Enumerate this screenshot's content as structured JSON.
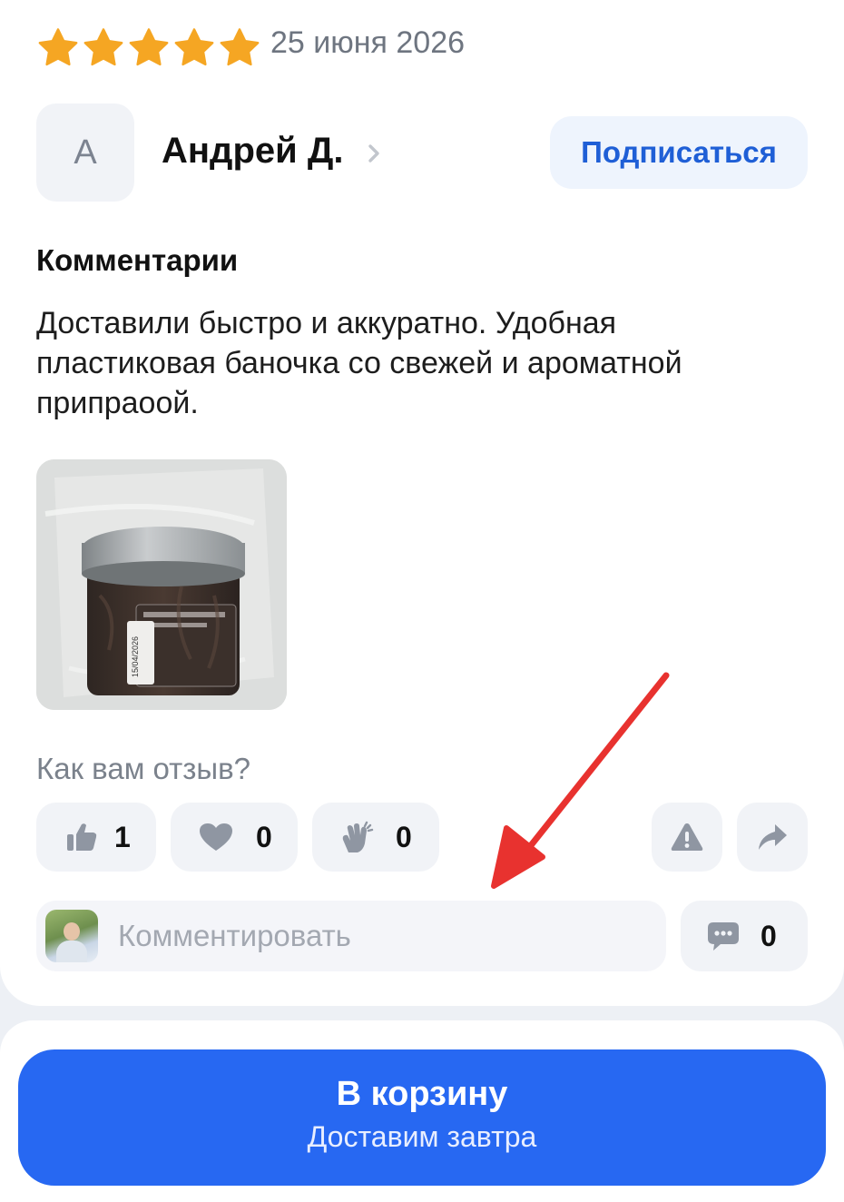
{
  "review": {
    "rating": 5,
    "date": "25 июня 2026",
    "author_initial": "А",
    "author_name": "Андрей Д.",
    "subscribe_label": "Подписаться",
    "comments_title": "Комментарии",
    "comment_text": "Доставили быстро и аккуратно. Удобная пластиковая баночка со свежей и ароматной припраоой.",
    "photo_label_date": "15/04/2026"
  },
  "feedback": {
    "question": "Как вам отзыв?",
    "likes": "1",
    "hearts": "0",
    "claps": "0"
  },
  "comment_box": {
    "placeholder": "Комментировать",
    "comments_count": "0"
  },
  "cart": {
    "button_label": "В корзину",
    "delivery_label": "Доставим завтра"
  },
  "colors": {
    "star": "#f5a623",
    "accent": "#2768f2",
    "subscribe_text": "#1f5fd6",
    "arrow": "#e8322f"
  },
  "icons": [
    "star-icon",
    "chevron-right-icon",
    "thumbs-up-icon",
    "heart-icon",
    "clap-icon",
    "warning-icon",
    "share-icon",
    "comment-icon"
  ]
}
